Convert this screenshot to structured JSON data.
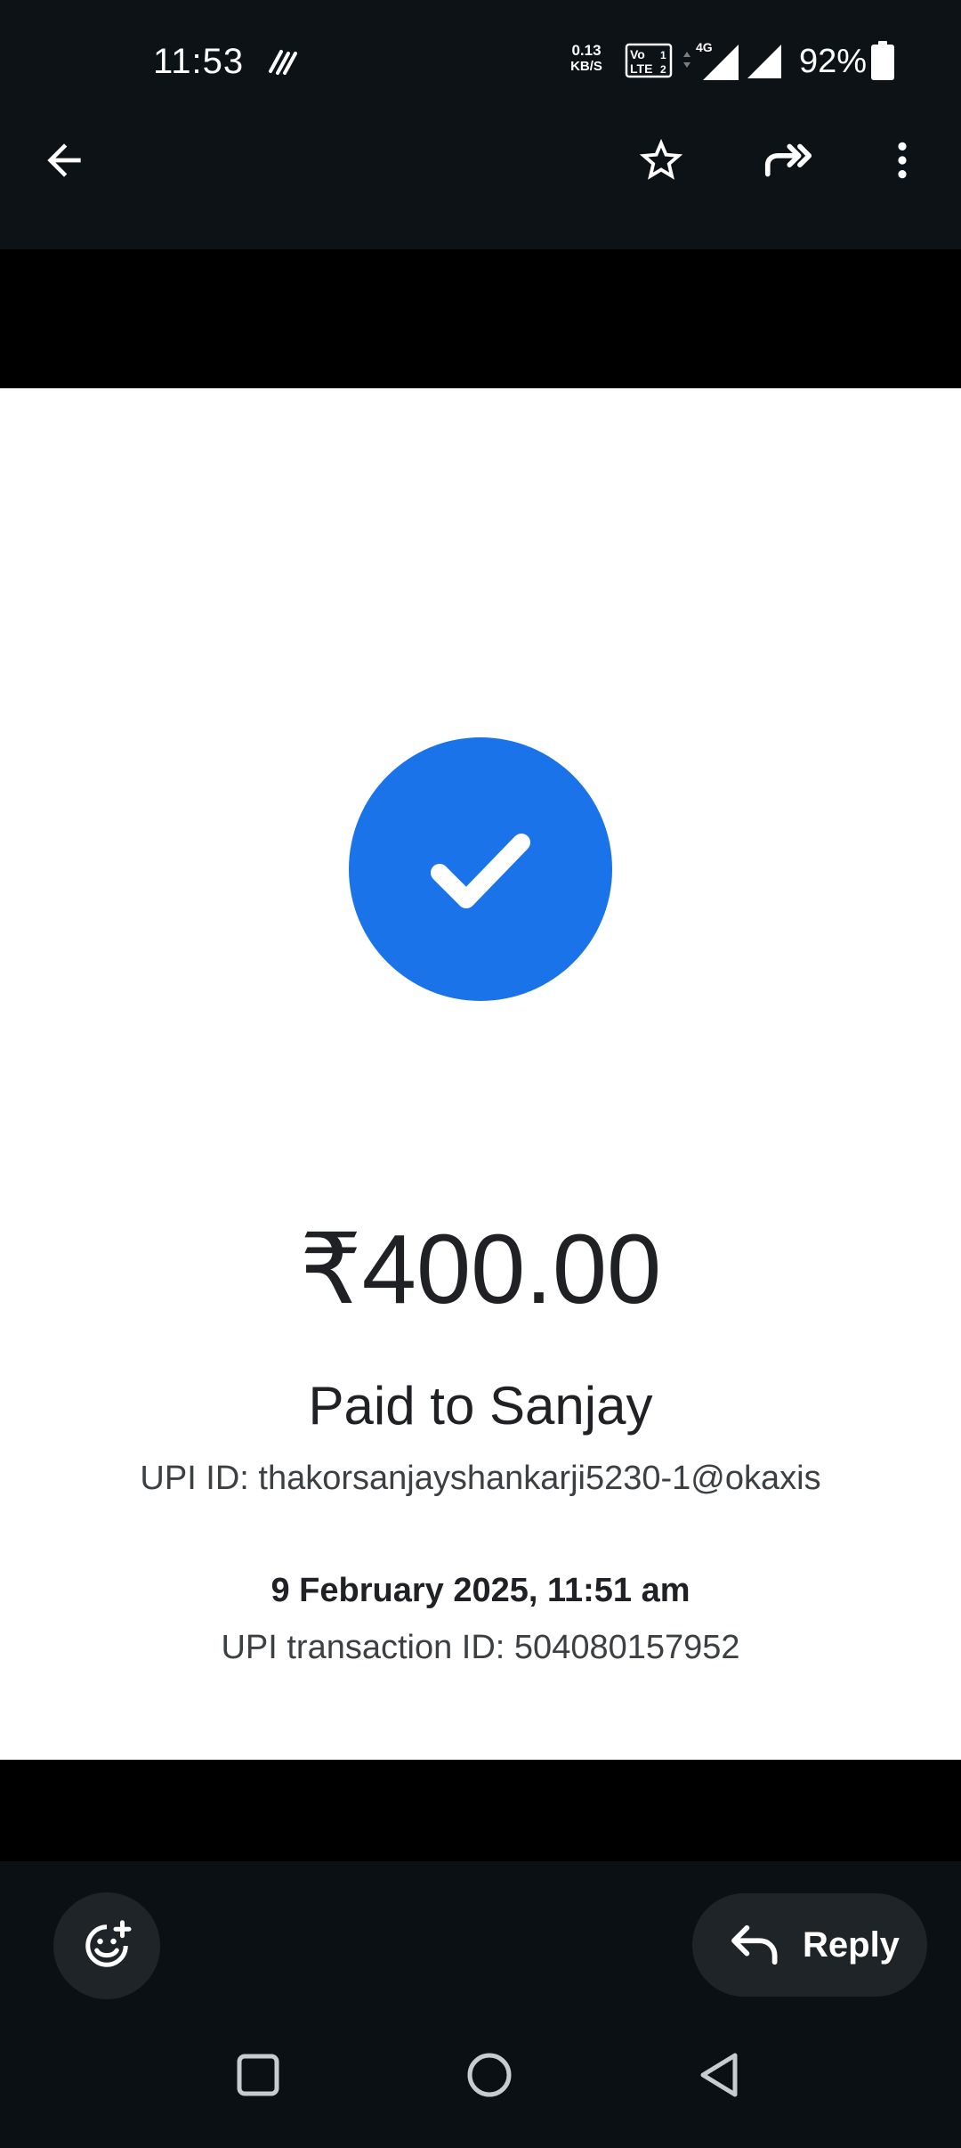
{
  "status_bar": {
    "time": "11:53",
    "net_speed_value": "0.13",
    "net_speed_unit": "KB/S",
    "network_type": "4G",
    "battery_percent": "92%",
    "volte_label_top": "Vo",
    "volte_label_bottom": "LTE",
    "sim1": "1",
    "sim2": "2"
  },
  "toolbar": {
    "icons": [
      "back-arrow-icon",
      "star-icon",
      "forward-icon",
      "more-vert-icon"
    ]
  },
  "receipt": {
    "amount": "₹400.00",
    "paid_to": "Paid to Sanjay",
    "upi_id": "UPI ID: thakorsanjayshankarji5230-1@okaxis",
    "date_time": "9 February 2025, 11:51 am",
    "transaction_id": "UPI transaction ID: 504080157952",
    "accent_color": "#1a73e8"
  },
  "bottom_bar": {
    "reply_label": "Reply",
    "icons": [
      "add-reaction-icon",
      "reply-arrow-icon"
    ]
  },
  "nav_bar": {
    "icons": [
      "recents-square-icon",
      "home-circle-icon",
      "back-triangle-icon"
    ]
  }
}
